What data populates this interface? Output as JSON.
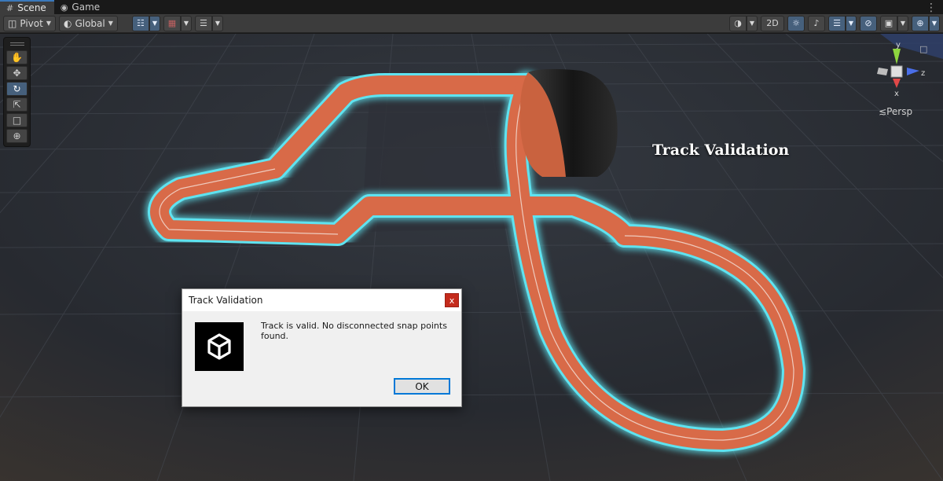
{
  "tabs": [
    {
      "label": "Scene",
      "icon": "grid-icon",
      "active": true
    },
    {
      "label": "Game",
      "icon": "gamepad-icon",
      "active": false
    }
  ],
  "toolbar": {
    "pivot_label": "Pivot",
    "global_label": "Global",
    "mode_2d_label": "2D"
  },
  "viewport": {
    "overlay_title": "Track Validation",
    "projection_label": "Persp",
    "gizmo_axes": {
      "y": "y",
      "x": "x",
      "z": "z"
    },
    "colors": {
      "track": "#d86a48",
      "outline": "#5fe3f0",
      "loop": "#1c1c1c",
      "grid": "#3f444c"
    }
  },
  "dialog": {
    "title": "Track Validation",
    "close_label": "x",
    "message": "Track is valid. No disconnected snap points found.",
    "ok_label": "OK"
  }
}
